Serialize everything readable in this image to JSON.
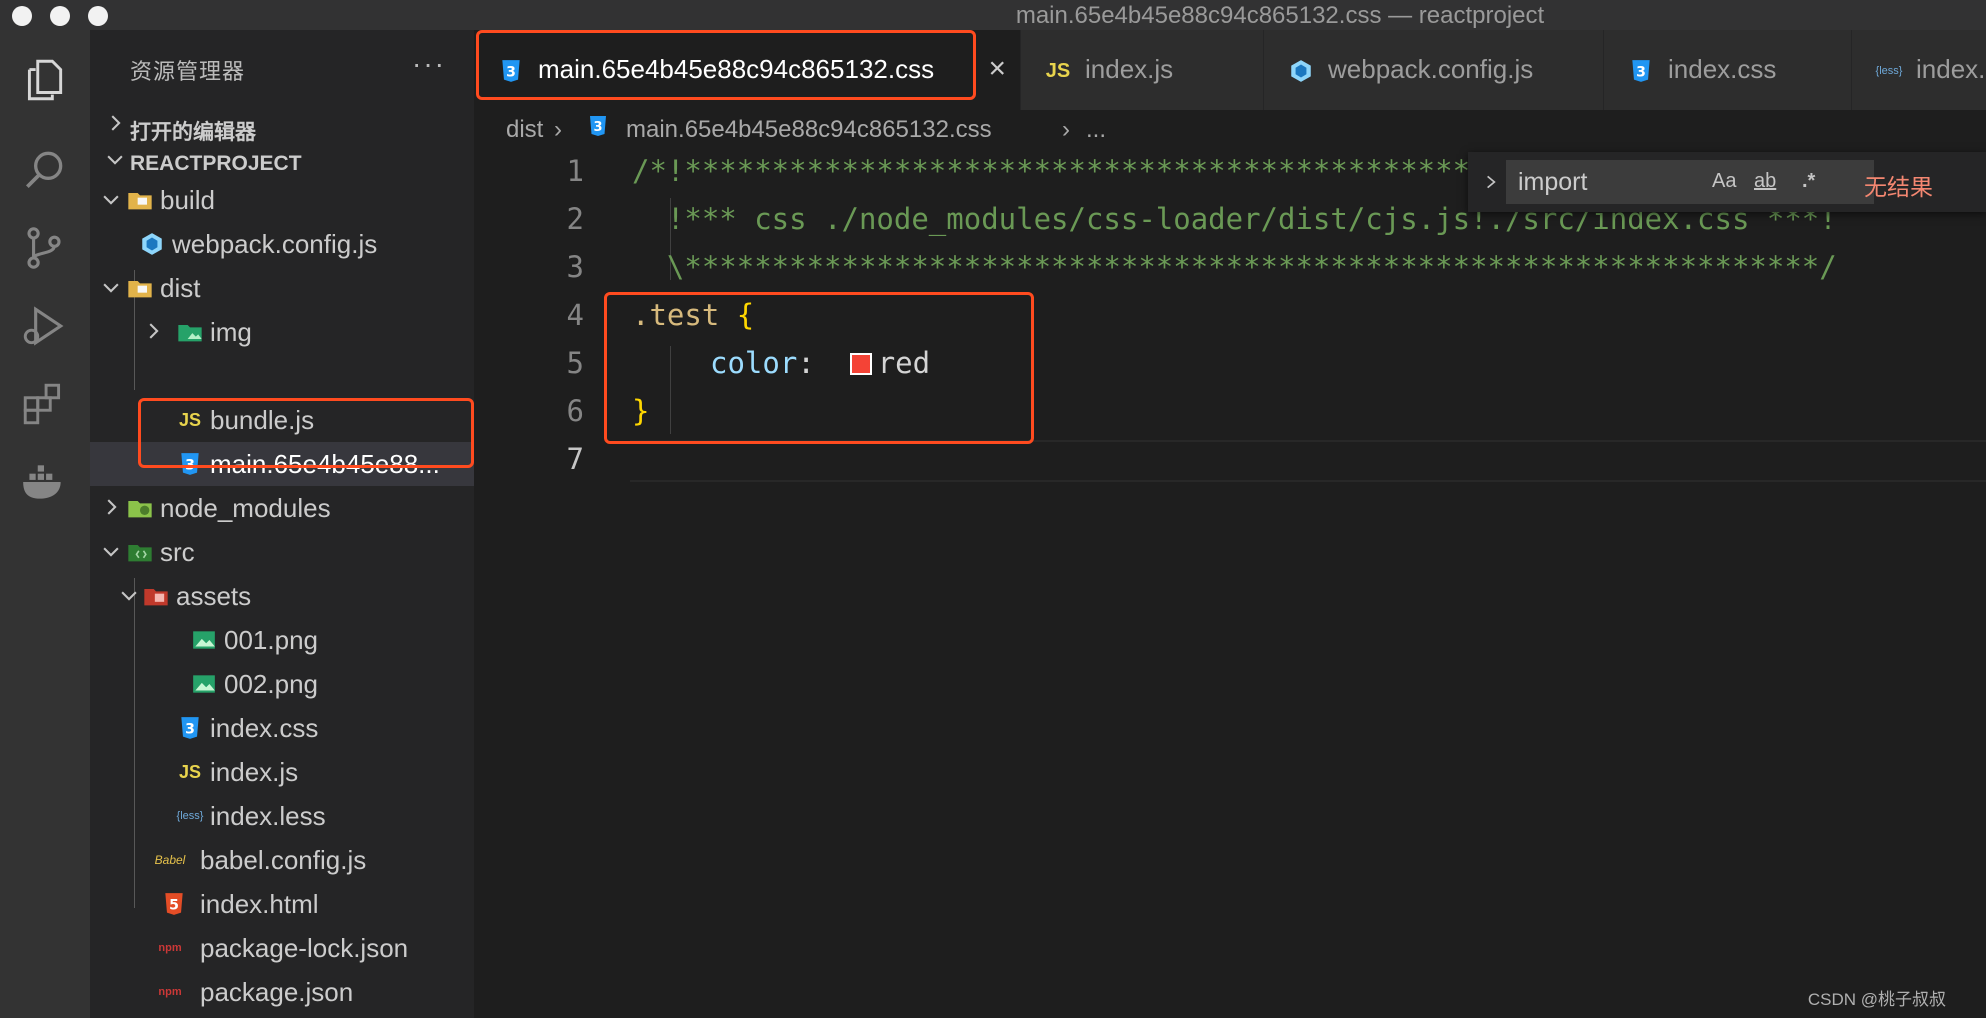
{
  "window": {
    "title": "main.65e4b45e88c94c865132.css — reactproject"
  },
  "explorer": {
    "header": "资源管理器",
    "more": "···",
    "open_editors": "打开的编辑器",
    "project": "REACTPROJECT",
    "tree": [
      {
        "name": "build",
        "type": "folder",
        "expanded": true
      },
      {
        "name": "webpack.config.js",
        "type": "webpack"
      },
      {
        "name": "dist",
        "type": "folder",
        "expanded": true
      },
      {
        "name": "img",
        "type": "img-folder",
        "expanded": false
      },
      {
        "name": "bundle.js",
        "type": "js"
      },
      {
        "name": "main.65e4b45e88...",
        "type": "css",
        "selected": true
      },
      {
        "name": "node_modules",
        "type": "node-folder",
        "expanded": false
      },
      {
        "name": "src",
        "type": "src-folder",
        "expanded": true
      },
      {
        "name": "assets",
        "type": "assets-folder",
        "expanded": true
      },
      {
        "name": "001.png",
        "type": "image"
      },
      {
        "name": "002.png",
        "type": "image"
      },
      {
        "name": "index.css",
        "type": "css"
      },
      {
        "name": "index.js",
        "type": "js"
      },
      {
        "name": "index.less",
        "type": "less"
      },
      {
        "name": "babel.config.js",
        "type": "babel"
      },
      {
        "name": "index.html",
        "type": "html"
      },
      {
        "name": "package-lock.json",
        "type": "npm"
      },
      {
        "name": "package.json",
        "type": "npm"
      }
    ]
  },
  "tabs": [
    {
      "label": "main.65e4b45e88c94c865132.css",
      "icon": "css-file-icon",
      "active": true,
      "close": "×"
    },
    {
      "label": "index.js",
      "icon": "js-file-icon"
    },
    {
      "label": "webpack.config.js",
      "icon": "webpack-file-icon"
    },
    {
      "label": "index.css",
      "icon": "css-file-icon"
    },
    {
      "label": "index.l",
      "icon": "less-file-icon"
    }
  ],
  "breadcrumb": {
    "folder": "dist",
    "file": "main.65e4b45e88c94c865132.css",
    "more": "..."
  },
  "editor": {
    "line_numbers": [
      "1",
      "2",
      "3",
      "4",
      "5",
      "6",
      "7"
    ],
    "line1": "/*!*****************************************************************",
    "line2": "  !*** css ./node_modules/css-loader/dist/cjs.js!./src/index.css ***!",
    "line3": "  \\*****************************************************************/",
    "selector": ".test",
    "open_brace": "{",
    "property": "color",
    "colon": ":",
    "value": "red",
    "swatch_color": "#f44336",
    "close_brace": "}"
  },
  "find": {
    "query": "import",
    "match_case": "Aa",
    "whole_word": "ab",
    "regex": ".*",
    "result": "无结果"
  },
  "highlight_color": "#ff4b1f",
  "watermark": "CSDN @桃子叔叔"
}
